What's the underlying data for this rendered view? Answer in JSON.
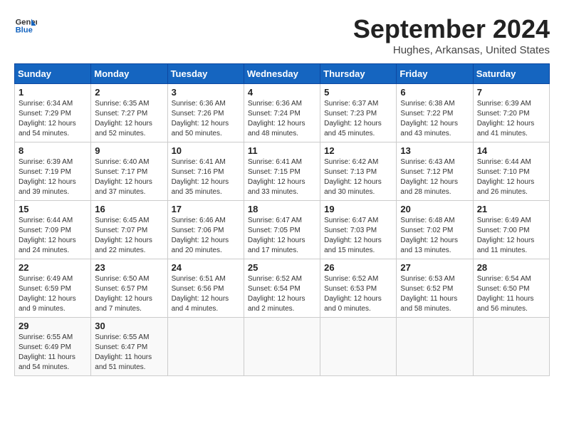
{
  "header": {
    "logo_line1": "General",
    "logo_line2": "Blue",
    "month": "September 2024",
    "location": "Hughes, Arkansas, United States"
  },
  "days_of_week": [
    "Sunday",
    "Monday",
    "Tuesday",
    "Wednesday",
    "Thursday",
    "Friday",
    "Saturday"
  ],
  "weeks": [
    [
      {
        "day": "1",
        "info": "Sunrise: 6:34 AM\nSunset: 7:29 PM\nDaylight: 12 hours\nand 54 minutes."
      },
      {
        "day": "2",
        "info": "Sunrise: 6:35 AM\nSunset: 7:27 PM\nDaylight: 12 hours\nand 52 minutes."
      },
      {
        "day": "3",
        "info": "Sunrise: 6:36 AM\nSunset: 7:26 PM\nDaylight: 12 hours\nand 50 minutes."
      },
      {
        "day": "4",
        "info": "Sunrise: 6:36 AM\nSunset: 7:24 PM\nDaylight: 12 hours\nand 48 minutes."
      },
      {
        "day": "5",
        "info": "Sunrise: 6:37 AM\nSunset: 7:23 PM\nDaylight: 12 hours\nand 45 minutes."
      },
      {
        "day": "6",
        "info": "Sunrise: 6:38 AM\nSunset: 7:22 PM\nDaylight: 12 hours\nand 43 minutes."
      },
      {
        "day": "7",
        "info": "Sunrise: 6:39 AM\nSunset: 7:20 PM\nDaylight: 12 hours\nand 41 minutes."
      }
    ],
    [
      {
        "day": "8",
        "info": "Sunrise: 6:39 AM\nSunset: 7:19 PM\nDaylight: 12 hours\nand 39 minutes."
      },
      {
        "day": "9",
        "info": "Sunrise: 6:40 AM\nSunset: 7:17 PM\nDaylight: 12 hours\nand 37 minutes."
      },
      {
        "day": "10",
        "info": "Sunrise: 6:41 AM\nSunset: 7:16 PM\nDaylight: 12 hours\nand 35 minutes."
      },
      {
        "day": "11",
        "info": "Sunrise: 6:41 AM\nSunset: 7:15 PM\nDaylight: 12 hours\nand 33 minutes."
      },
      {
        "day": "12",
        "info": "Sunrise: 6:42 AM\nSunset: 7:13 PM\nDaylight: 12 hours\nand 30 minutes."
      },
      {
        "day": "13",
        "info": "Sunrise: 6:43 AM\nSunset: 7:12 PM\nDaylight: 12 hours\nand 28 minutes."
      },
      {
        "day": "14",
        "info": "Sunrise: 6:44 AM\nSunset: 7:10 PM\nDaylight: 12 hours\nand 26 minutes."
      }
    ],
    [
      {
        "day": "15",
        "info": "Sunrise: 6:44 AM\nSunset: 7:09 PM\nDaylight: 12 hours\nand 24 minutes."
      },
      {
        "day": "16",
        "info": "Sunrise: 6:45 AM\nSunset: 7:07 PM\nDaylight: 12 hours\nand 22 minutes."
      },
      {
        "day": "17",
        "info": "Sunrise: 6:46 AM\nSunset: 7:06 PM\nDaylight: 12 hours\nand 20 minutes."
      },
      {
        "day": "18",
        "info": "Sunrise: 6:47 AM\nSunset: 7:05 PM\nDaylight: 12 hours\nand 17 minutes."
      },
      {
        "day": "19",
        "info": "Sunrise: 6:47 AM\nSunset: 7:03 PM\nDaylight: 12 hours\nand 15 minutes."
      },
      {
        "day": "20",
        "info": "Sunrise: 6:48 AM\nSunset: 7:02 PM\nDaylight: 12 hours\nand 13 minutes."
      },
      {
        "day": "21",
        "info": "Sunrise: 6:49 AM\nSunset: 7:00 PM\nDaylight: 12 hours\nand 11 minutes."
      }
    ],
    [
      {
        "day": "22",
        "info": "Sunrise: 6:49 AM\nSunset: 6:59 PM\nDaylight: 12 hours\nand 9 minutes."
      },
      {
        "day": "23",
        "info": "Sunrise: 6:50 AM\nSunset: 6:57 PM\nDaylight: 12 hours\nand 7 minutes."
      },
      {
        "day": "24",
        "info": "Sunrise: 6:51 AM\nSunset: 6:56 PM\nDaylight: 12 hours\nand 4 minutes."
      },
      {
        "day": "25",
        "info": "Sunrise: 6:52 AM\nSunset: 6:54 PM\nDaylight: 12 hours\nand 2 minutes."
      },
      {
        "day": "26",
        "info": "Sunrise: 6:52 AM\nSunset: 6:53 PM\nDaylight: 12 hours\nand 0 minutes."
      },
      {
        "day": "27",
        "info": "Sunrise: 6:53 AM\nSunset: 6:52 PM\nDaylight: 11 hours\nand 58 minutes."
      },
      {
        "day": "28",
        "info": "Sunrise: 6:54 AM\nSunset: 6:50 PM\nDaylight: 11 hours\nand 56 minutes."
      }
    ],
    [
      {
        "day": "29",
        "info": "Sunrise: 6:55 AM\nSunset: 6:49 PM\nDaylight: 11 hours\nand 54 minutes."
      },
      {
        "day": "30",
        "info": "Sunrise: 6:55 AM\nSunset: 6:47 PM\nDaylight: 11 hours\nand 51 minutes."
      },
      {
        "day": "",
        "info": ""
      },
      {
        "day": "",
        "info": ""
      },
      {
        "day": "",
        "info": ""
      },
      {
        "day": "",
        "info": ""
      },
      {
        "day": "",
        "info": ""
      }
    ]
  ]
}
